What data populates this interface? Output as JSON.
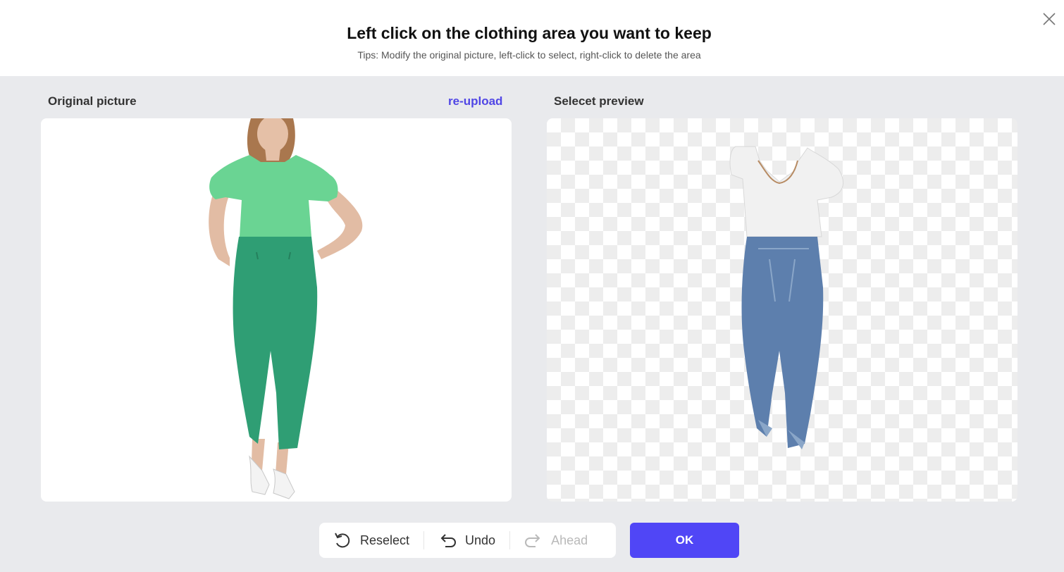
{
  "dialog": {
    "title": "Left click on the clothing area you want to keep",
    "tip": "Tips: Modify the original picture, left-click to select, right-click to delete the area",
    "close_icon": "close-icon"
  },
  "original": {
    "label": "Original picture",
    "reupload_label": "re-upload"
  },
  "preview": {
    "label": "Selecet preview"
  },
  "toolbar": {
    "reselect_label": "Reselect",
    "undo_label": "Undo",
    "ahead_label": "Ahead",
    "ok_label": "OK"
  },
  "colors": {
    "accent": "#5046f6",
    "link": "#5046e5",
    "selection_top": "#6ad493",
    "selection_jeans": "#2f9e74"
  }
}
